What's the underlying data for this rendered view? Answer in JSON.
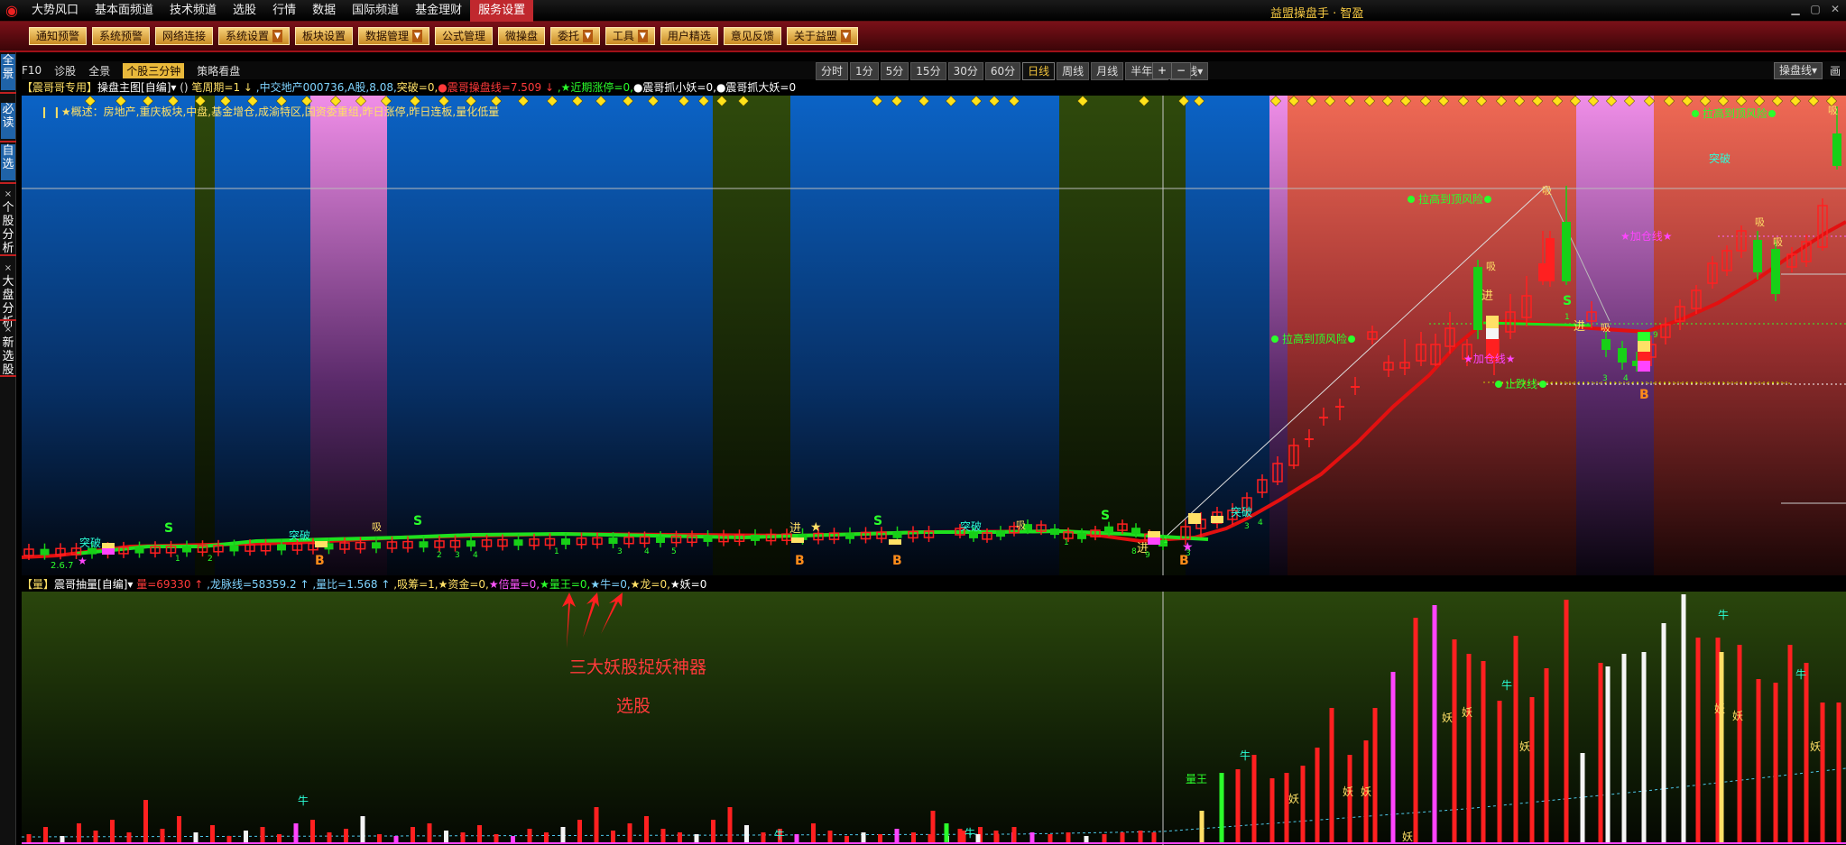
{
  "menubar": {
    "logo": "◉",
    "items": [
      "大势风口",
      "基本面频道",
      "技术频道",
      "选股",
      "行情",
      "数据",
      "国际频道",
      "基金理财",
      "服务设置"
    ],
    "active_index": 8,
    "app_title": "益盟操盘手 · 智盈",
    "window_controls": [
      "minimize",
      "maximize",
      "close"
    ]
  },
  "toolbar": {
    "buttons": [
      {
        "label": "通知预警",
        "dropdown": false
      },
      {
        "label": "系统预警",
        "dropdown": false
      },
      {
        "label": "网络连接",
        "dropdown": false
      },
      {
        "label": "系统设置",
        "dropdown": true
      },
      {
        "label": "板块设置",
        "dropdown": false
      },
      {
        "label": "数据管理",
        "dropdown": true
      },
      {
        "label": "公式管理",
        "dropdown": false
      },
      {
        "label": "微操盘",
        "dropdown": false
      },
      {
        "label": "委托",
        "dropdown": true
      },
      {
        "label": "工具",
        "dropdown": true
      },
      {
        "label": "用户精选",
        "dropdown": false
      },
      {
        "label": "意见反馈",
        "dropdown": false
      },
      {
        "label": "关于益盟",
        "dropdown": true
      }
    ]
  },
  "leftbar": {
    "tabs": [
      {
        "label": "全景",
        "active": true
      },
      {
        "label": "必读",
        "active": true
      },
      {
        "label": "自选",
        "active": true
      },
      {
        "label": "个股分析",
        "active": false
      },
      {
        "label": "大盘分析",
        "active": false
      },
      {
        "label": "新选股",
        "active": false
      }
    ]
  },
  "strip": {
    "items": [
      "F10",
      "诊股",
      "全景",
      "个股三分钟",
      "策略看盘"
    ],
    "highlight_index": 3,
    "periods": [
      "分时",
      "1分",
      "5分",
      "15分",
      "30分",
      "60分",
      "日线",
      "周线",
      "月线",
      "半年线",
      "年线▾"
    ],
    "selected_period": "日线",
    "zoom_in": "+",
    "zoom_out": "−",
    "right_selector": "操盘线▾",
    "right_label": "画线"
  },
  "infobar": {
    "segments": [
      {
        "text": "【震哥哥专用】",
        "color": "#ffe066"
      },
      {
        "text": "操盘主图[自编]▾",
        "color": "#ffffff"
      },
      {
        "text": " () ",
        "color": "#dddddd"
      },
      {
        "text": "笔周期=1 ↓",
        "color": "#ffe066"
      },
      {
        "text": " ,中交地产000736,A股,8.08,",
        "color": "#7fd4ff"
      },
      {
        "text": "突破=0,",
        "color": "#ffe066"
      },
      {
        "text": "●震哥操盘线=7.509 ↓",
        "color": "#ff3a3a"
      },
      {
        "text": " ,★近期涨停=0,",
        "color": "#2bff2b"
      },
      {
        "text": "●震哥抓小妖=0,",
        "color": "#ffffff"
      },
      {
        "text": "●震哥抓大妖=0",
        "color": "#ffffff"
      }
    ]
  },
  "description": "❙ ❙★概述：房地产,重庆板块,中盘,基金增仓,成渝特区,国资委重组,昨日涨停,昨日连板,量化低量",
  "chart_labels": {
    "risk1": "拉高到顶风险",
    "risk2": "拉高到顶风险",
    "risk3": "拉高到顶风险",
    "stop_line": "止跌线",
    "add_pos": "★加仓线★",
    "add_pos2": "★加仓线★",
    "breakout": "突破",
    "enter": "进",
    "buy": "B",
    "sell": "S",
    "absorb": "吸",
    "green_stub": "2.6.7",
    "small_nums": [
      "1",
      "2",
      "3",
      "4",
      "5",
      "6",
      "7",
      "8",
      "9"
    ]
  },
  "volinfo": {
    "segments": [
      {
        "text": "【量】",
        "color": "#ffe066"
      },
      {
        "text": "震哥抽量[自编]▾",
        "color": "#ffffff"
      },
      {
        "text": " 量=69330 ↑",
        "color": "#ff3a3a"
      },
      {
        "text": " ,龙脉线=58359.2 ↑",
        "color": "#7fd4ff"
      },
      {
        "text": " ,量比=1.568 ↑",
        "color": "#7fd4ff"
      },
      {
        "text": " ,吸筹=1,",
        "color": "#ffe066"
      },
      {
        "text": "★资金=0,",
        "color": "#ffe066"
      },
      {
        "text": "★倍量=0,",
        "color": "#ff55ff"
      },
      {
        "text": "★量王=0,",
        "color": "#2bff2b"
      },
      {
        "text": "★牛=0,",
        "color": "#7fd4ff"
      },
      {
        "text": "★龙=0,",
        "color": "#ffe066"
      },
      {
        "text": "★妖=0",
        "color": "#ffffff"
      }
    ]
  },
  "vol_labels": {
    "king": "量王",
    "niu": "牛",
    "yao": "妖"
  },
  "annotation": {
    "line1": "三大妖股捉妖神器",
    "line2": "选股"
  },
  "colors": {
    "up": "#ff2020",
    "down": "#17d017",
    "ma_main": "#e31010",
    "ma_green": "#1ee01e",
    "accent": "#f2c43c",
    "brand": "#c0282e"
  }
}
